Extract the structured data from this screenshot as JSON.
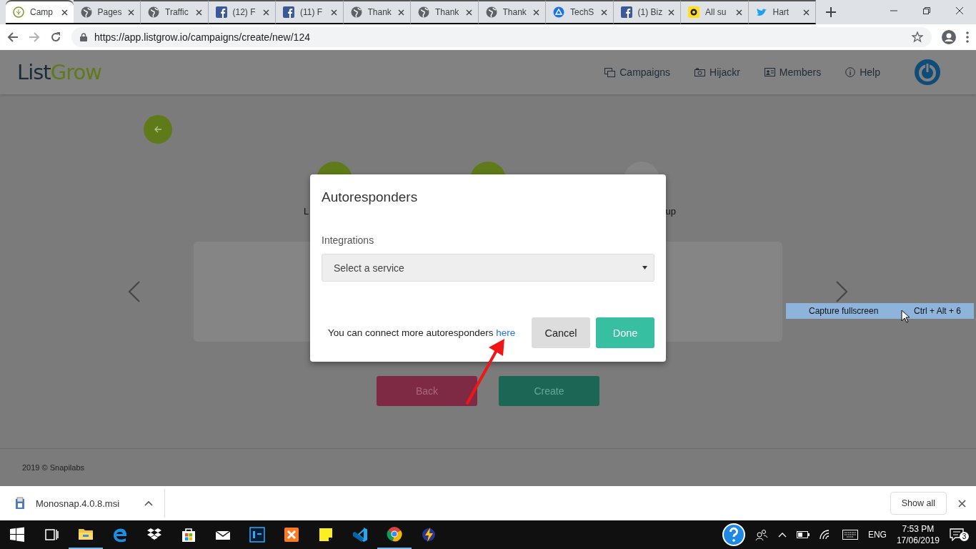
{
  "browser": {
    "tabs": [
      {
        "label": "Camp",
        "selected": true
      },
      {
        "label": "Pages",
        "selected": false
      },
      {
        "label": "Traffic",
        "selected": false
      },
      {
        "label": "(12) F",
        "selected": false
      },
      {
        "label": "(11) F",
        "selected": false
      },
      {
        "label": "Thank",
        "selected": false
      },
      {
        "label": "Thank",
        "selected": false
      },
      {
        "label": "Thank",
        "selected": false
      },
      {
        "label": "TechS",
        "selected": false
      },
      {
        "label": "(1) Biz",
        "selected": false
      },
      {
        "label": "All su",
        "selected": false
      },
      {
        "label": "Hart",
        "selected": false
      }
    ],
    "url": "https://app.listgrow.io/campaigns/create/new/124"
  },
  "app": {
    "logo": {
      "part_1": "List",
      "part_2": "Grow"
    },
    "nav": [
      "Campaigns",
      "Hijackr",
      "Members",
      "Help"
    ],
    "steps": [
      {
        "label": "L",
        "done": true
      },
      {
        "done": true
      },
      {
        "label": "up",
        "done": false
      }
    ],
    "buttons": [
      {
        "label": "Back",
        "kind": "back"
      },
      {
        "label": "Create",
        "kind": "create"
      }
    ],
    "footer": "2019 © Snapilabs"
  },
  "modal": {
    "title": "Autoresponders",
    "field_label": "Integrations",
    "select": {
      "placeholder": "Select a service"
    },
    "note": "You can connect more autoresponders",
    "link": "here",
    "buttons": [
      {
        "label": "Cancel",
        "kind": "secondary"
      },
      {
        "label": "Done",
        "kind": "primary"
      }
    ]
  },
  "tooltip": {
    "label": "Capture fullscreen",
    "shortcut": "Ctrl + Alt + 6"
  },
  "downloads": {
    "file": "Monosnap.4.0.8.msi",
    "button": "Show all"
  },
  "taskbar": {
    "language": "ENG",
    "time": "7:53 PM",
    "date": "17/06/2019",
    "notifications": "3"
  }
}
